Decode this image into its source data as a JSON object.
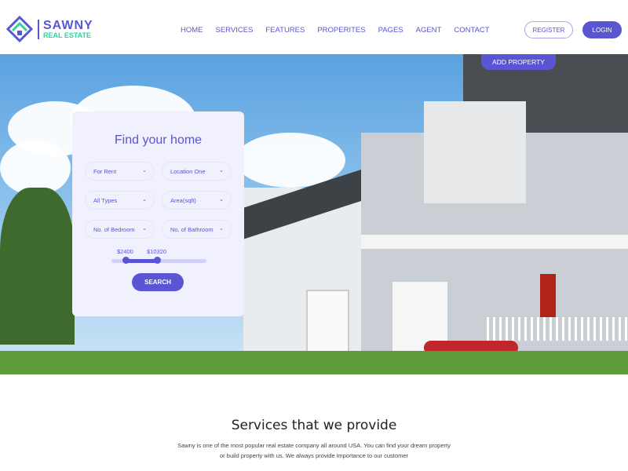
{
  "brand": {
    "name": "SAWNY",
    "tagline": "REAL ESTATE",
    "primary_color": "#5a55d2",
    "accent_color": "#2dd4a0"
  },
  "nav": {
    "items": [
      "HOME",
      "SERVICES",
      "FEATURES",
      "PROPERITES",
      "PAGES",
      "AGENT",
      "CONTACT"
    ]
  },
  "auth": {
    "register": "REGISTER",
    "login": "LOGIN"
  },
  "hero": {
    "add_property": "ADD PROPERTY"
  },
  "search_card": {
    "title": "Find your home",
    "selects": [
      "For Rent",
      "Location One",
      "All Types",
      "Area(sqft)",
      "No. of Bedroom",
      "No. of Bathroom"
    ],
    "price_min": "$2400",
    "price_max": "$10320",
    "range_fraction": [
      0.15,
      0.48
    ],
    "search_label": "SEARCH"
  },
  "services": {
    "title": "Services that we provide",
    "description": "Sawny is one of the most popular real estate company all around USA. You can find your dream property or build property with us. We always provide importance to our customer"
  }
}
